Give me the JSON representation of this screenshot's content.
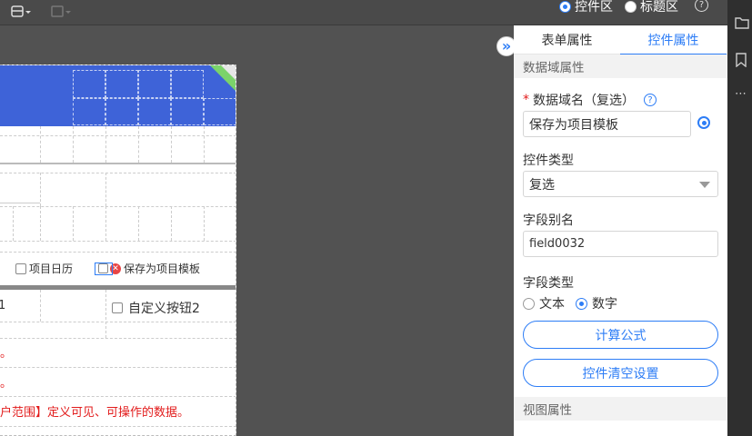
{
  "toolbar": {
    "radio_control_area": "控件区",
    "radio_title_area": "标题区",
    "help": "?"
  },
  "panel": {
    "tabs": [
      "表单属性",
      "控件属性"
    ],
    "active_tab": 1,
    "section_data_domain": "数据域属性",
    "data_domain_label": "数据域名（复选）",
    "required_mark": "*",
    "help_mark": "?",
    "data_domain_value": "保存为项目模板",
    "control_type_label": "控件类型",
    "control_type_value": "复选",
    "field_alias_label": "字段别名",
    "field_alias_value": "field0032",
    "field_type_label": "字段类型",
    "field_type_options": [
      "文本",
      "数字"
    ],
    "field_type_selected": "数字",
    "calc_formula_button": "计算公式",
    "clear_settings_button": "控件清空设置",
    "section_view": "视图属性"
  },
  "canvas": {
    "checkbox_project_calendar": "项目日历",
    "checkbox_save_template": "保存为项目模板",
    "custom_button_1_fragment": "1",
    "checkbox_custom_button_2": "自定义按钮2",
    "red_line_1": "。",
    "red_line_2": "。",
    "red_line_3": "户范围】定义可见、可操作的数据。"
  },
  "colors": {
    "accent": "#2d7df6",
    "header_blue": "#3e63d8",
    "warning_red": "#e21b1b",
    "background_dark": "#525252"
  },
  "icons": {
    "collapse_toggle": "»"
  }
}
